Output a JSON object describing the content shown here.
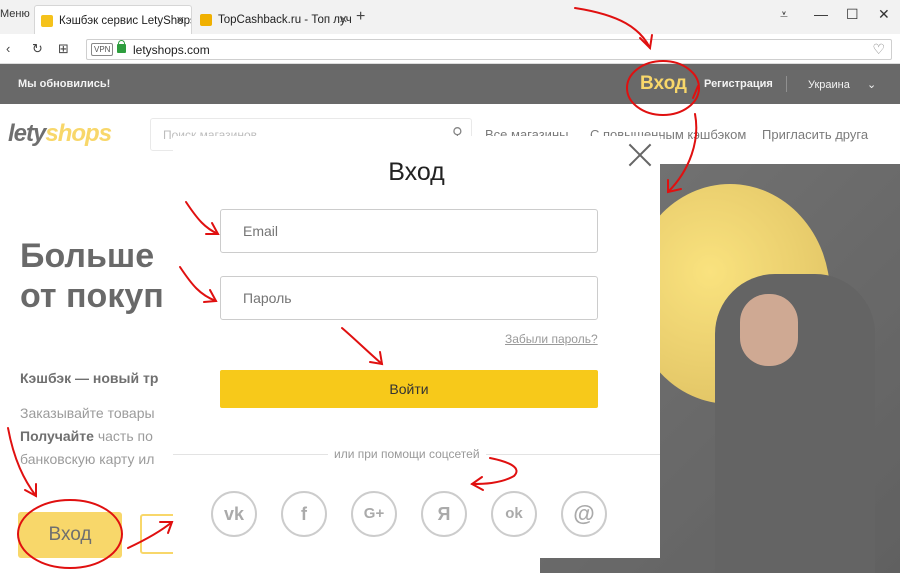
{
  "browser": {
    "menu_tab": "Меню",
    "tabs": [
      {
        "title": "Кэшбэк сервис LetyShops",
        "close": "✕",
        "favicon_color": "#f5c21b"
      },
      {
        "title": "TopCashback.ru - Топ луч",
        "close": "✕",
        "favicon_color": "#f0b000"
      }
    ],
    "new_tab": "+",
    "window_controls": [
      "⩡",
      "—",
      "☐",
      "✕"
    ],
    "nav": [
      "‹",
      "↻",
      "⊞"
    ],
    "vpn": "VPN",
    "url": "letyshops.com",
    "bookmark_icon": "♡"
  },
  "site": {
    "update_notice": "Мы обновились!",
    "login_top": "Вход",
    "register_top": "Регистрация",
    "country": "Украина",
    "country_chevron": "⌄",
    "logo": {
      "prefix": "lety",
      "suffix": "shops"
    },
    "search_placeholder": "Поиск магазинов",
    "search_icon": "⚲",
    "nav_links": [
      "Все магазины",
      "С повышенным кэшбэком",
      "Пригласить друга"
    ],
    "hero_line1": "Больше",
    "hero_line2": "от покуп",
    "subheading": "Кэшбэк — новый тр",
    "para_line1": "Заказывайте товары",
    "para_bold": "Получайте",
    "para_line2_rest": " часть по",
    "para_line3": "банковскую карту ил",
    "login_button": "Вход"
  },
  "modal": {
    "title": "Вход",
    "email_placeholder": "Email",
    "password_placeholder": "Пароль",
    "forgot": "Забыли пароль?",
    "login_button": "Войти",
    "social_label": "или при помощи соцсетей",
    "socials": [
      {
        "name": "vk",
        "glyph": "vk"
      },
      {
        "name": "facebook",
        "glyph": "f"
      },
      {
        "name": "google-plus",
        "glyph": "G+"
      },
      {
        "name": "yandex",
        "glyph": "Я"
      },
      {
        "name": "odnoklassniki",
        "glyph": "ok"
      },
      {
        "name": "mail",
        "glyph": "@"
      }
    ]
  },
  "colors": {
    "brand_yellow": "#f5c21b",
    "annotation_red": "#e01010"
  }
}
